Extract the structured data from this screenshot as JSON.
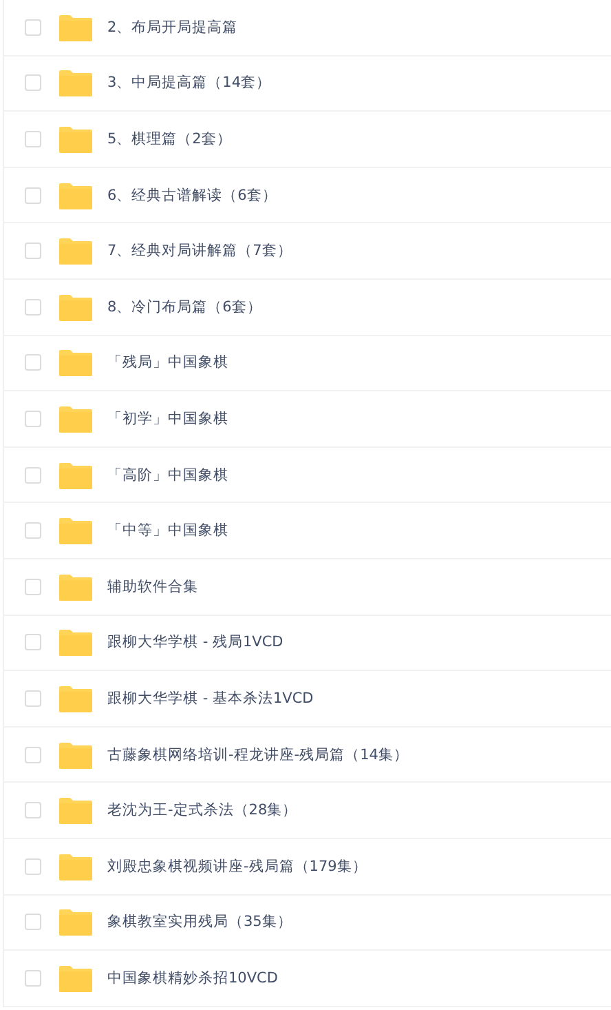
{
  "files": [
    {
      "name": "2、布局开局提高篇",
      "checked": false
    },
    {
      "name": "3、中局提高篇（14套）",
      "checked": false
    },
    {
      "name": "5、棋理篇（2套）",
      "checked": false
    },
    {
      "name": "6、经典古谱解读（6套）",
      "checked": false
    },
    {
      "name": "7、经典对局讲解篇（7套）",
      "checked": false
    },
    {
      "name": "8、冷门布局篇（6套）",
      "checked": false
    },
    {
      "name": "「残局」中国象棋",
      "checked": false
    },
    {
      "name": "「初学」中国象棋",
      "checked": false
    },
    {
      "name": "「高阶」中国象棋",
      "checked": false
    },
    {
      "name": "「中等」中国象棋",
      "checked": false
    },
    {
      "name": "辅助软件合集",
      "checked": false
    },
    {
      "name": "跟柳大华学棋 - 残局1VCD",
      "checked": false
    },
    {
      "name": "跟柳大华学棋 - 基本杀法1VCD",
      "checked": false
    },
    {
      "name": "古藤象棋网络培训-程龙讲座-残局篇（14集）",
      "checked": false
    },
    {
      "name": "老沈为王-定式杀法（28集）",
      "checked": false
    },
    {
      "name": "刘殿忠象棋视频讲座-残局篇（179集）",
      "checked": false
    },
    {
      "name": "象棋教室实用残局（35集）",
      "checked": false
    },
    {
      "name": "中国象棋精妙杀招10VCD",
      "checked": false
    }
  ]
}
